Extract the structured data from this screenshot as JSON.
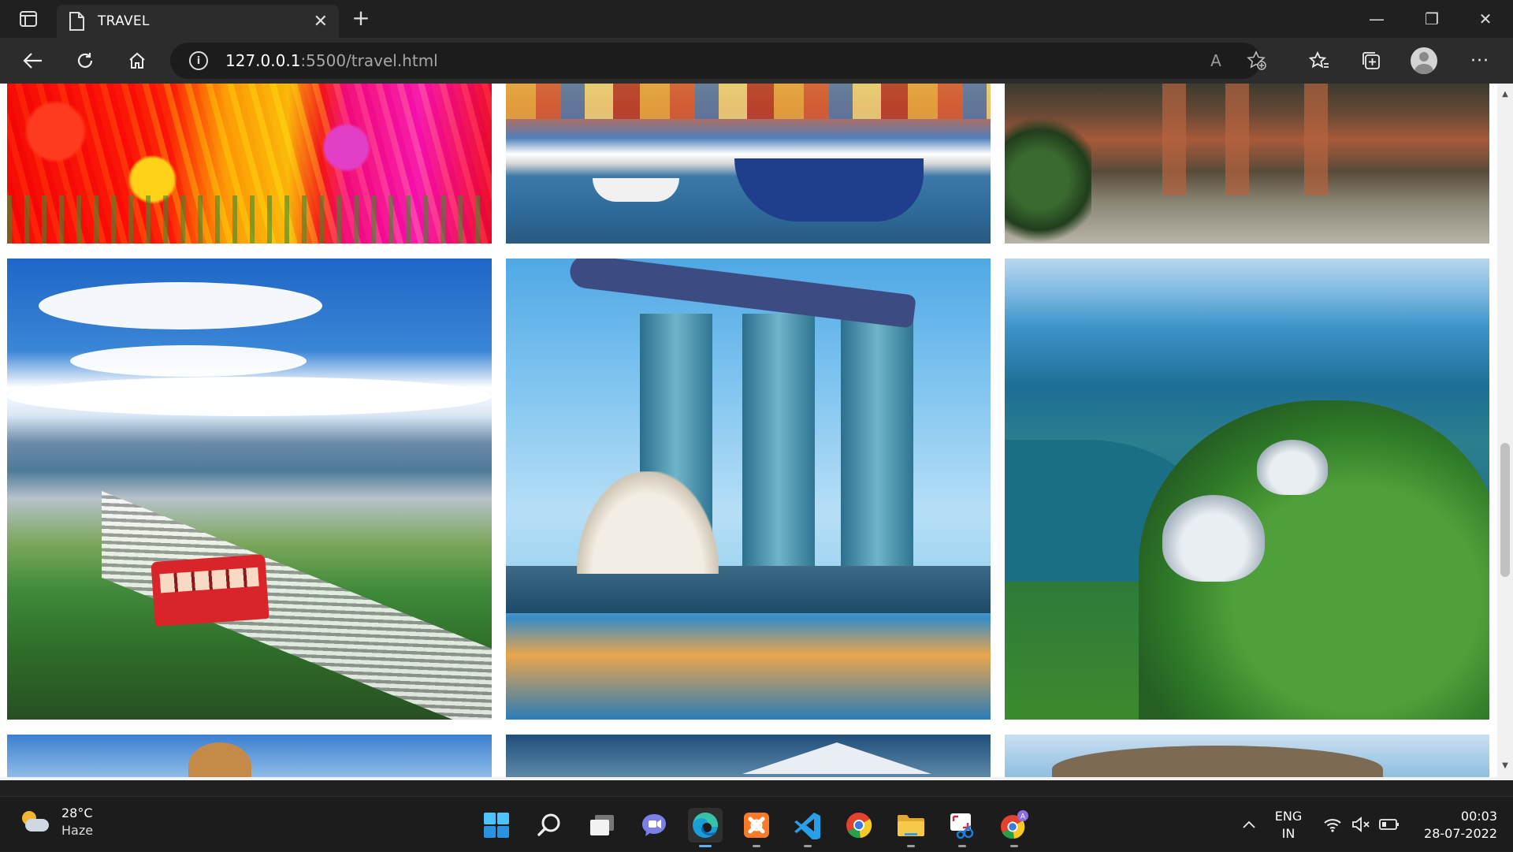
{
  "browser": {
    "tab_title": "TRAVEL",
    "tab_close": "✕",
    "new_tab": "+",
    "address": {
      "host": "127.0.0.1",
      "path": ":5500/travel.html"
    },
    "window_controls": {
      "minimize": "—",
      "maximize": "❐",
      "close": "✕"
    },
    "info_glyph": "i",
    "read_aloud_glyph": "A",
    "more_glyph": "···"
  },
  "page": {
    "background": "#ffffff",
    "gallery": [
      {
        "name": "tulip-field-photo"
      },
      {
        "name": "harbour-boats-photo"
      },
      {
        "name": "canal-reflection-photo"
      },
      {
        "name": "wellington-cable-car-photo"
      },
      {
        "name": "marina-bay-sands-photo"
      },
      {
        "name": "gardens-by-the-bay-photo"
      },
      {
        "name": "dome-city-photo"
      },
      {
        "name": "snow-mountain-photo"
      },
      {
        "name": "coastal-hills-photo"
      }
    ]
  },
  "taskbar": {
    "weather": {
      "temperature": "28°C",
      "condition": "Haze"
    },
    "language": {
      "line1": "ENG",
      "line2": "IN"
    },
    "clock": {
      "time": "00:03",
      "date": "28-07-2022"
    },
    "apps": [
      "start-icon",
      "search-icon",
      "task-view-icon",
      "teams-chat-icon",
      "edge-icon",
      "xampp-icon",
      "vscode-icon",
      "chrome-icon",
      "file-explorer-icon",
      "snipping-tool-icon",
      "chrome-profile-icon"
    ],
    "accent": "#5fb2f2"
  }
}
